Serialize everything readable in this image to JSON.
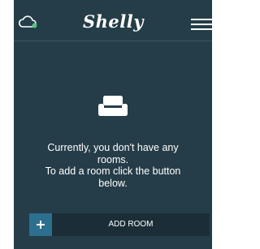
{
  "header": {
    "logo_text": "Shelly",
    "cloud_icon": "cloud-sync-icon",
    "menu_icon": "hamburger-menu-icon"
  },
  "empty_state": {
    "icon": "sofa-icon",
    "line1": "Currently, you don't have any",
    "line2": "rooms.",
    "line3": "To add a room click the button",
    "line4": "below."
  },
  "add_room": {
    "icon": "plus-icon",
    "label": "ADD ROOM"
  },
  "colors": {
    "background": "#253d48",
    "button_bar": "#1b2e37",
    "accent": "#2d6f8e",
    "text": "#ffffff"
  }
}
